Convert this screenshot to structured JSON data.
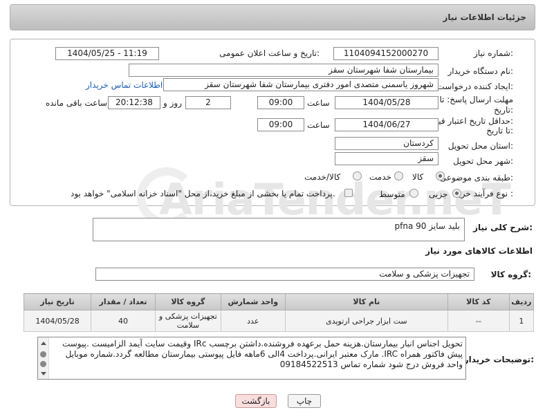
{
  "header": {
    "title": "جزئیات اطلاعات نیاز"
  },
  "form": {
    "need_number_label": "شماره نیاز:",
    "need_number": "1104094152000270",
    "announce_label": "تاریخ و ساعت اعلان عمومی:",
    "announce_value": "1404/05/25 - 11:19",
    "buyer_org_label": "نام دستگاه خریدار:",
    "buyer_org": "بیمارستان شفا شهرستان سقز",
    "creator_label": "ایجاد کننده درخواست:",
    "creator": "شهروز یاسمنی متصدی امور دفتری بیمارستان شفا شهرستان سقز",
    "contact_link": "اطلاعات تماس خریدار",
    "deadline_label_1": "مهلت ارسال پاسخ: تا",
    "deadline_label_2": "تاریخ:",
    "deadline_date": "1404/05/28",
    "time_label": "ساعت",
    "deadline_time": "09:00",
    "days_value": "2",
    "days_label": "روز و",
    "remaining_time": "20:12:38",
    "remaining_label": "ساعت باقی مانده",
    "price_label_1": "حداقل تاریخ اعتبار قیمت:",
    "price_label_2": "تا تاریخ:",
    "price_date": "1404/06/27",
    "price_time_label": "ساعت",
    "price_time": "09:00",
    "province_label": "استان محل تحویل:",
    "province": "کردستان",
    "city_label": "شهر محل تحویل:",
    "city": "سقز",
    "category_label": "طبقه بندی موضوعی:",
    "category_options": [
      "کالا",
      "خدمت",
      "کالا/خدمت"
    ],
    "process_label": "نوع فرآیند خرید :",
    "process_options": [
      "جزیی",
      "متوسط"
    ],
    "payment_note": "پرداخت تمام یا بخشی از مبلغ خرید،از محل \"اسناد خزانه اسلامی\" خواهد بود."
  },
  "description": {
    "label": "شرح کلی نیاز:",
    "value": "بلید سایز 90 pfna"
  },
  "goods_info_title": "اطلاعات کالاهای مورد نیاز",
  "goods_group": {
    "label": "گروه کالا:",
    "value": "تجهیزات پزشکی و سلامت"
  },
  "table": {
    "headers": [
      "ردیف",
      "کد کالا",
      "نام کالا",
      "واحد شمارش",
      "گروه کالا",
      "تعداد / مقدار",
      "تاریخ نیاز"
    ],
    "rows": [
      [
        "1",
        "--",
        "ست ابزار جراحی ارتوپدی",
        "عدد",
        "تجهیزات پزشکی و سلامت",
        "40",
        "1404/05/28"
      ]
    ]
  },
  "buyer_notes": {
    "label": "توضیحات خریدار:",
    "value": "تحویل اجناس انبار بیمارستان.هزینه حمل برعهده فروشنده.داشتن برچسب IRc وقیمت سایت آیمد الزامیست .پیوست پیش فاکتور همراه IRC. مارک معتبر ایرانی.پرداخت 4الی 6ماهه فایل پیوستی بیمارستان مطالعه گردد.شماره موبایل واحد فروش درج شود شماره تماس 09184522513"
  },
  "buttons": {
    "print": "چاپ",
    "back": "بازگشت"
  },
  "watermark": "AriaTender.neT",
  "colors": {
    "link": "#1a5fb4",
    "back_button": "#f9dede",
    "print_button": "#f4f4f4"
  }
}
